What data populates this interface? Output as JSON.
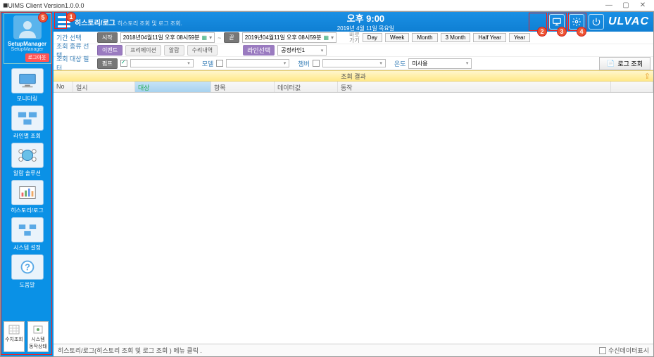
{
  "window": {
    "title": "UIMS Client Version1.0.0.0"
  },
  "header": {
    "page_title": "히스토리/로그",
    "page_sub": "히스토리 조회 및 로그 조회.",
    "clock_time": "오후 9:00",
    "clock_date": "2019년 4월 11일 목요일",
    "brand": "ULVAC"
  },
  "sidebar": {
    "user_label": "No Photo",
    "user_name": "SetupManager",
    "user_role": "SetupManager",
    "logout": "로그아웃",
    "items": [
      {
        "label": "모니터링"
      },
      {
        "label": "라인별 조회"
      },
      {
        "label": "알람 솔루션"
      },
      {
        "label": "히스토리/로그"
      },
      {
        "label": "시스템 설정"
      },
      {
        "label": "도움말"
      }
    ],
    "mini": [
      {
        "label": "수치조회"
      },
      {
        "label": "시스템\n동작상태"
      }
    ]
  },
  "filters": {
    "period_label": "기간 선택",
    "start_label": "시작",
    "start_value": "2018년04월11일 오후 08시59분",
    "end_label": "끝",
    "end_value": "2019년04월11일 오후 08시59분",
    "goto_label": "바로\n가기",
    "ranges": [
      "Day",
      "Week",
      "Month",
      "3 Month",
      "Half Year",
      "Year"
    ],
    "type_label": "조회 종류 선택",
    "types": [
      "이벤트",
      "프리메이션",
      "알람",
      "수리내역"
    ],
    "line_label": "라인선택",
    "line_value": "공정라인1",
    "target_label": "조회 대상 필터",
    "pump_label": "펌프",
    "pump_value": "",
    "model_label": "모델",
    "model_value": "",
    "chamber_label": "챔버",
    "chamber_value": "",
    "temp_label": "온도",
    "temp_value": "미사용",
    "log_btn": "로그 조회"
  },
  "results": {
    "header": "조회 결과",
    "columns": [
      "No",
      "일시",
      "대상",
      "항목",
      "데이터값",
      "동작",
      ""
    ]
  },
  "status": {
    "text": "히스토리/로그(히스토리 조회 및 로그 조회 ) 메뉴 클릭 .",
    "rx_label": "수신데이터표시"
  },
  "badges": {
    "b1": "1",
    "b2": "2",
    "b3": "3",
    "b4": "4",
    "b5": "5"
  }
}
